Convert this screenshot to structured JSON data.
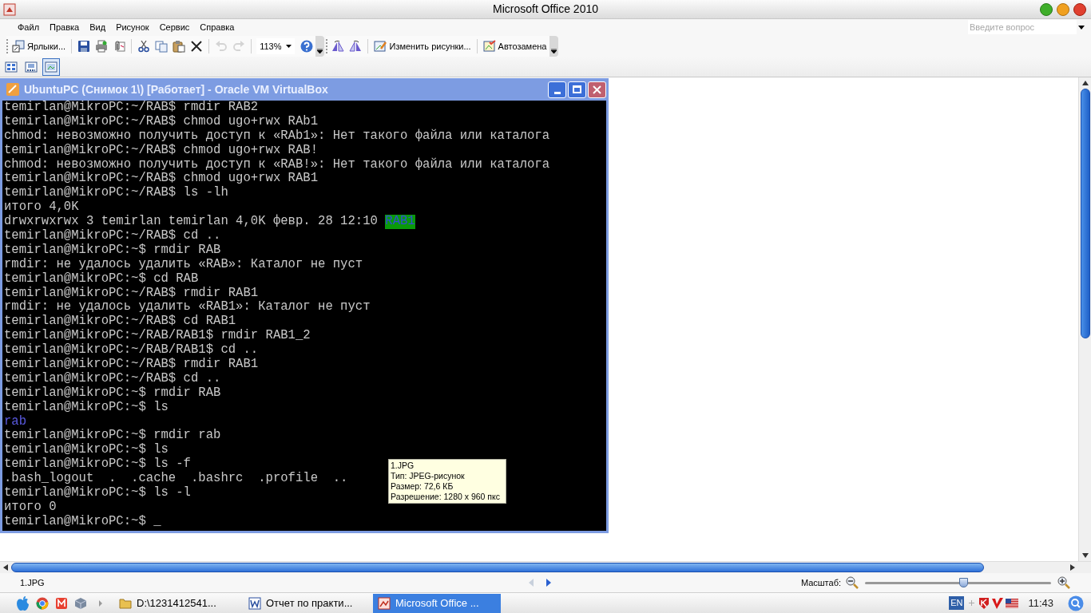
{
  "window": {
    "title": "Microsoft Office 2010"
  },
  "menu": [
    {
      "label": "Файл"
    },
    {
      "label": "Правка"
    },
    {
      "label": "Вид"
    },
    {
      "label": "Рисунок"
    },
    {
      "label": "Сервис"
    },
    {
      "label": "Справка"
    }
  ],
  "help_search": {
    "placeholder": "Введите вопрос"
  },
  "toolbar_1": [
    {
      "kind": "shortcuts",
      "label": "Ярлыки...",
      "disabled": false
    },
    {
      "kind": "save",
      "disabled": false
    },
    {
      "kind": "print",
      "disabled": false
    },
    {
      "kind": "attach",
      "disabled": false
    },
    {
      "kind": "cut",
      "disabled": false
    },
    {
      "kind": "copy",
      "disabled": false
    },
    {
      "kind": "paste",
      "disabled": false
    },
    {
      "kind": "delete",
      "disabled": false
    },
    {
      "kind": "undo",
      "disabled": true
    },
    {
      "kind": "redo",
      "disabled": true
    },
    {
      "kind": "zoom",
      "label": "113%",
      "disabled": false
    },
    {
      "kind": "help",
      "disabled": false
    }
  ],
  "toolbar_2": [
    {
      "kind": "rotate-left",
      "disabled": false
    },
    {
      "kind": "rotate-right",
      "disabled": false
    },
    {
      "kind": "edit",
      "label": "Изменить рисунки...",
      "disabled": false
    },
    {
      "kind": "autocorrect",
      "label": "Автозамена",
      "disabled": false
    }
  ],
  "view_buttons": [
    {
      "kind": "thumbnails",
      "selected": false
    },
    {
      "kind": "filmstrip",
      "selected": false
    },
    {
      "kind": "single",
      "selected": true
    }
  ],
  "image": {
    "title": "UbuntuPC (Снимок 1\\) [Работает] - Oracle VM VirtualBox",
    "lines": [
      {
        "text": "temirlan@MikroPC:~/RAB$ rmdir RAB2"
      },
      {
        "text": "temirlan@MikroPC:~/RAB$ chmod ugo+rwx RAb1"
      },
      {
        "text": "chmod: невозможно получить доступ к «RAb1»: Нет такого файла или каталога"
      },
      {
        "text": "temirlan@MikroPC:~/RAB$ chmod ugo+rwx RAB!"
      },
      {
        "text": "chmod: невозможно получить доступ к «RAB!»: Нет такого файла или каталога"
      },
      {
        "text": "temirlan@MikroPC:~/RAB$ chmod ugo+rwx RAB1"
      },
      {
        "text": "temirlan@MikroPC:~/RAB$ ls -lh"
      },
      {
        "text": "итого 4,0K"
      },
      {
        "text": "drwxrwxrwx 3 temirlan temirlan 4,0K февр. 28 12:10",
        "highlight": "RAB1"
      },
      {
        "text": "temirlan@MikroPC:~/RAB$ cd .."
      },
      {
        "text": "temirlan@MikroPC:~$ rmdir RAB"
      },
      {
        "text": "rmdir: не удалось удалить «RAB»: Каталог не пуст"
      },
      {
        "text": "temirlan@MikroPC:~$ cd RAB"
      },
      {
        "text": "temirlan@MikroPC:~/RAB$ rmdir RAB1"
      },
      {
        "text": "rmdir: не удалось удалить «RAB1»: Каталог не пуст"
      },
      {
        "text": "temirlan@MikroPC:~/RAB$ cd RAB1"
      },
      {
        "text": "temirlan@MikroPC:~/RAB/RAB1$ rmdir RAB1_2"
      },
      {
        "text": "temirlan@MikroPC:~/RAB/RAB1$ cd .."
      },
      {
        "text": "temirlan@MikroPC:~/RAB$ rmdir RAB1"
      },
      {
        "text": "temirlan@MikroPC:~/RAB$ cd .."
      },
      {
        "text": "temirlan@MikroPC:~$ rmdir RAB"
      },
      {
        "text": "temirlan@MikroPC:~$ ls"
      },
      {
        "text": "rab",
        "kind": "dir"
      },
      {
        "text": "temirlan@MikroPC:~$ rmdir rab"
      },
      {
        "text": "temirlan@MikroPC:~$ ls"
      },
      {
        "text": "temirlan@MikroPC:~$ ls -f"
      },
      {
        "text": ".bash_logout  .  .cache  .bashrc  .profile  .."
      },
      {
        "text": "temirlan@MikroPC:~$ ls -l"
      },
      {
        "text": "итого 0"
      },
      {
        "text": "temirlan@MikroPC:~$ _"
      }
    ]
  },
  "tooltip": [
    "1.JPG",
    "Тип: JPEG-рисунок",
    "Размер: 72,6 КБ",
    "Разрешение: 1280 x 960 пкс"
  ],
  "status_bar": {
    "file": "1.JPG",
    "zoom_label": "Масштаб:",
    "zoom_slider": {
      "level": 0.53
    }
  },
  "taskbar": {
    "items": [
      {
        "kind": "folder",
        "label": "D:\\1231412541...",
        "selected": false
      },
      {
        "kind": "word",
        "label": "Отчет по практи...",
        "selected": false
      },
      {
        "kind": "picture-manager",
        "label": "Microsoft Office ...",
        "selected": true
      }
    ],
    "language": "EN",
    "clock": "11:43"
  }
}
